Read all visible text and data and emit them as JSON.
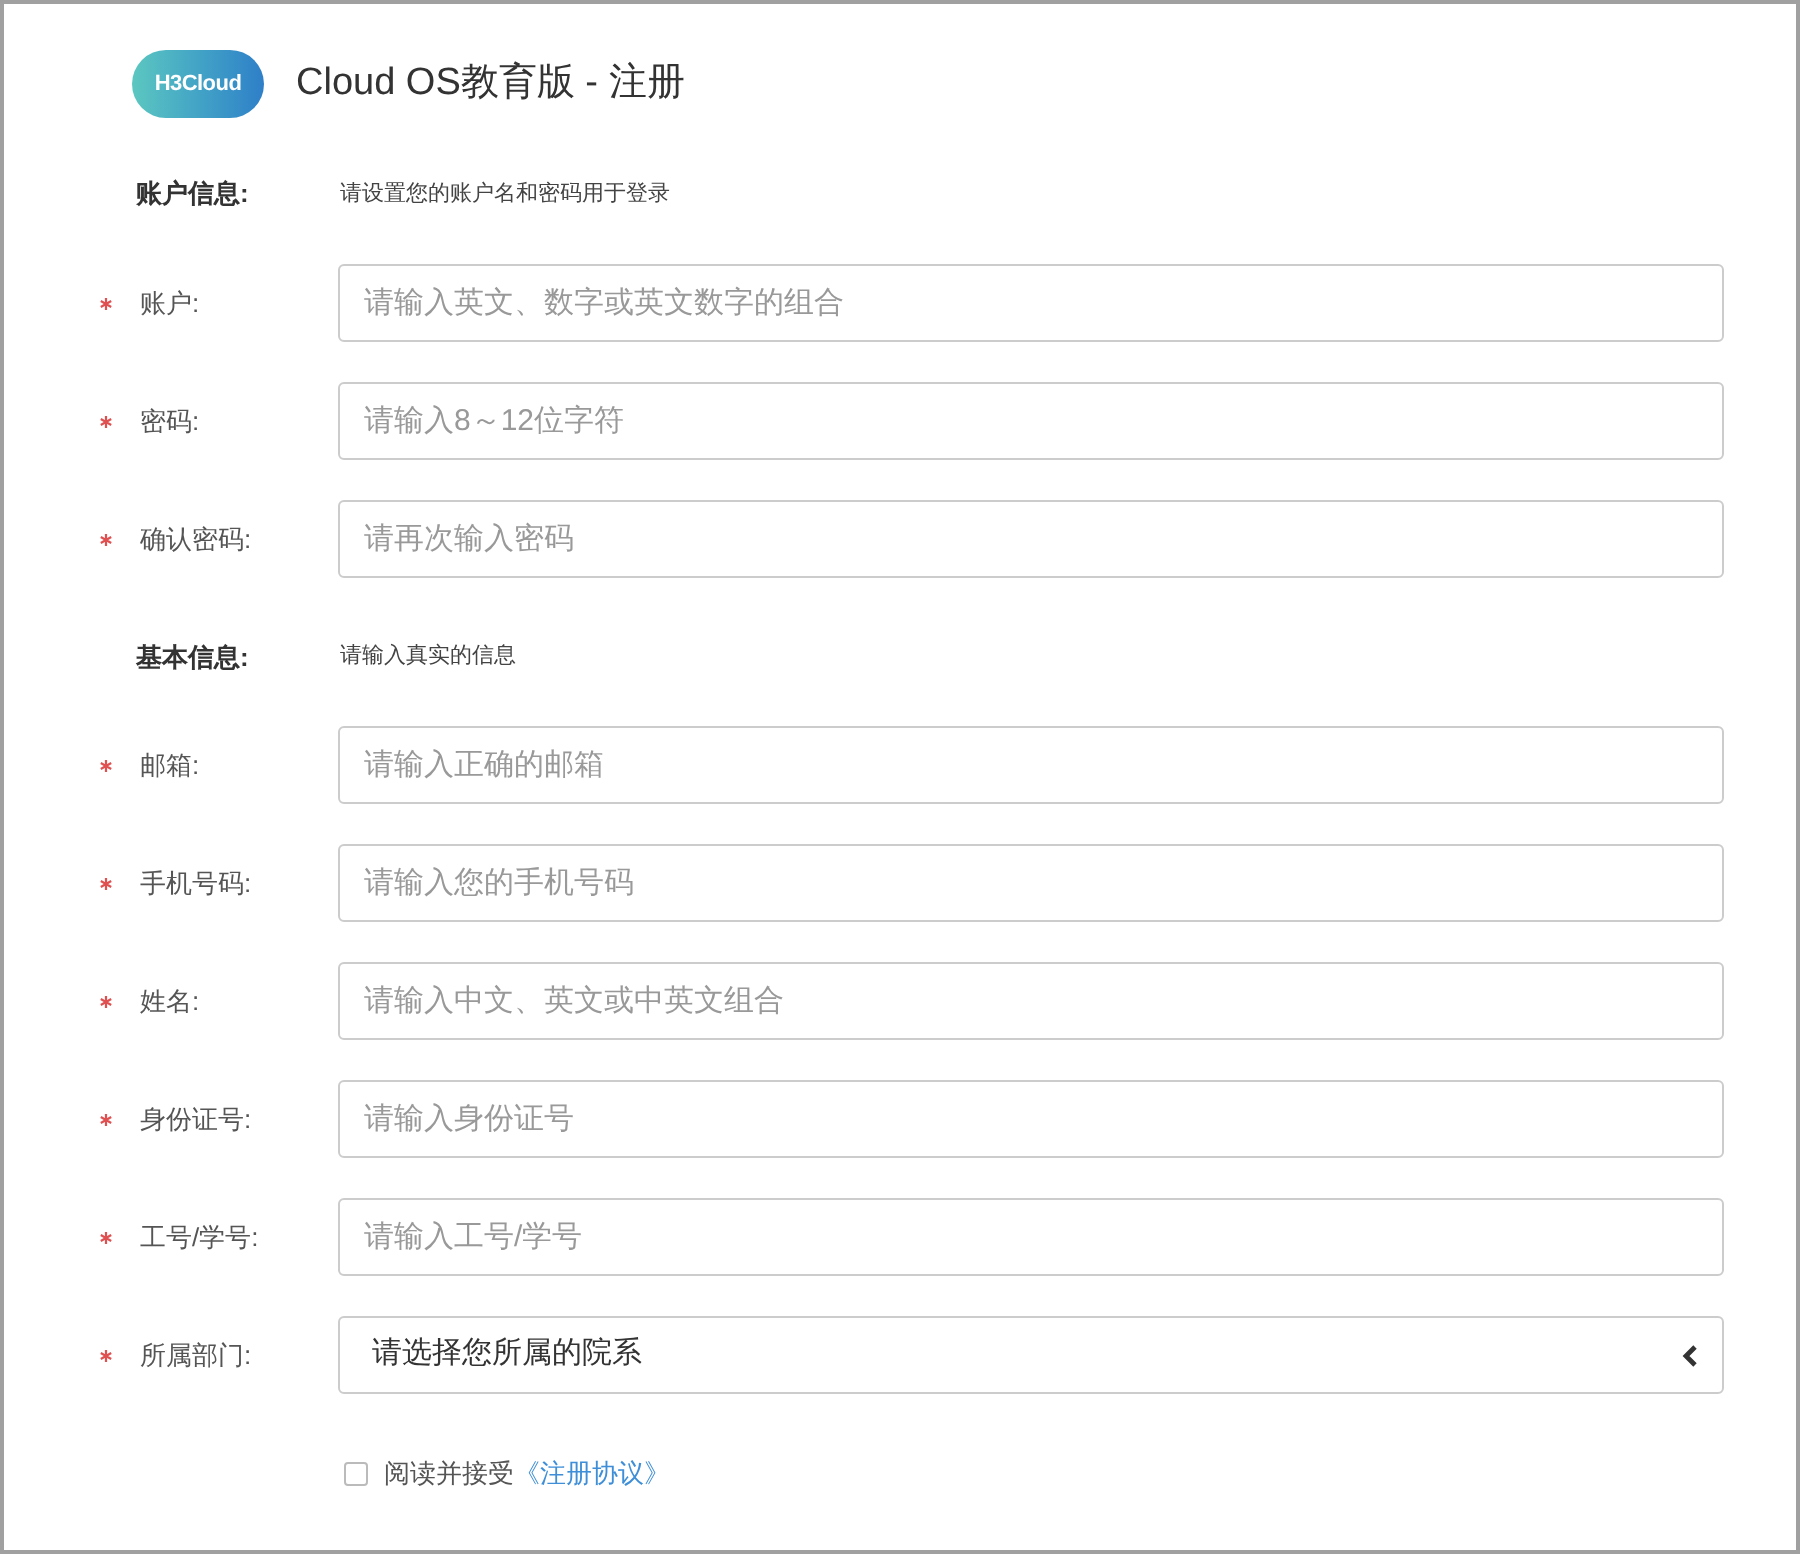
{
  "header": {
    "logo": "H3Cloud",
    "title": "Cloud OS教育版 - 注册"
  },
  "sections": [
    {
      "title": "账户信息:",
      "hint": "请设置您的账户名和密码用于登录",
      "fields": [
        {
          "kind": "input",
          "required": true,
          "label": "账户:",
          "placeholder": "请输入英文、数字或英文数字的组合"
        },
        {
          "kind": "input",
          "required": true,
          "label": "密码:",
          "placeholder": "请输入8～12位字符"
        },
        {
          "kind": "input",
          "required": true,
          "label": "确认密码:",
          "placeholder": "请再次输入密码"
        }
      ]
    },
    {
      "title": "基本信息:",
      "hint": "请输入真实的信息",
      "fields": [
        {
          "kind": "input",
          "required": true,
          "label": "邮箱:",
          "placeholder": "请输入正确的邮箱"
        },
        {
          "kind": "input",
          "required": true,
          "label": "手机号码:",
          "placeholder": "请输入您的手机号码"
        },
        {
          "kind": "input",
          "required": true,
          "label": "姓名:",
          "placeholder": "请输入中文、英文或中英文组合"
        },
        {
          "kind": "input",
          "required": true,
          "label": "身份证号:",
          "placeholder": "请输入身份证号"
        },
        {
          "kind": "input",
          "required": true,
          "label": "工号/学号:",
          "placeholder": "请输入工号/学号"
        },
        {
          "kind": "select",
          "required": true,
          "label": "所属部门:",
          "value": "请选择您所属的院系"
        }
      ]
    }
  ],
  "agreement": {
    "checked": false,
    "text": "阅读并接受",
    "link": "《注册协议》"
  }
}
